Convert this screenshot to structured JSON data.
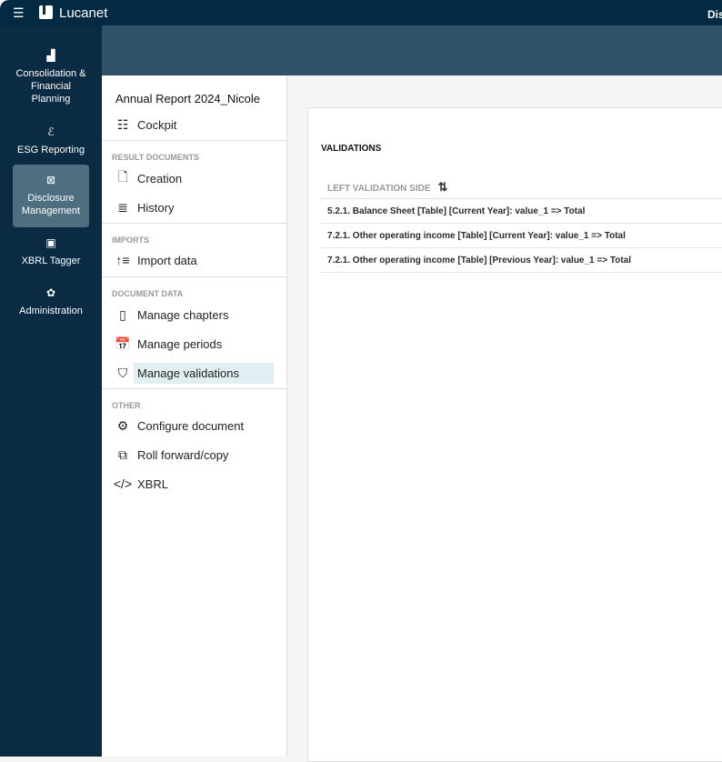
{
  "topbar": {
    "brand": "Lucanet",
    "right_title": "Dis"
  },
  "rail": [
    {
      "icon": "chart-icon",
      "label": "Consolidation & Financial Planning"
    },
    {
      "icon": "esg-icon",
      "label": "ESG Reporting"
    },
    {
      "icon": "disclosure-icon",
      "label": "Disclosure Management",
      "active": true
    },
    {
      "icon": "xbrl-icon",
      "label": "XBRL Tagger"
    },
    {
      "icon": "gear-icon",
      "label": "Administration"
    }
  ],
  "nav": {
    "title": "Annual Report 2024_Nicole",
    "cockpit": "Cockpit",
    "sections": {
      "result": "RESULT DOCUMENTS",
      "imports": "IMPORTS",
      "docdata": "DOCUMENT DATA",
      "other": "OTHER"
    },
    "items": {
      "creation": "Creation",
      "history": "History",
      "import": "Import data",
      "chapters": "Manage chapters",
      "periods": "Manage periods",
      "validations": "Manage validations",
      "configure": "Configure document",
      "roll": "Roll forward/copy",
      "xbrl": "XBRL"
    }
  },
  "main": {
    "heading": "VALIDATIONS",
    "column": "LEFT VALIDATION SIDE",
    "rows": [
      "5.2.1. Balance Sheet [Table] [Current Year]: value_1 => Total",
      "7.2.1. Other operating income [Table] [Current Year]: value_1 => Total",
      "7.2.1. Other operating income [Table] [Previous Year]: value_1 => Total"
    ]
  }
}
